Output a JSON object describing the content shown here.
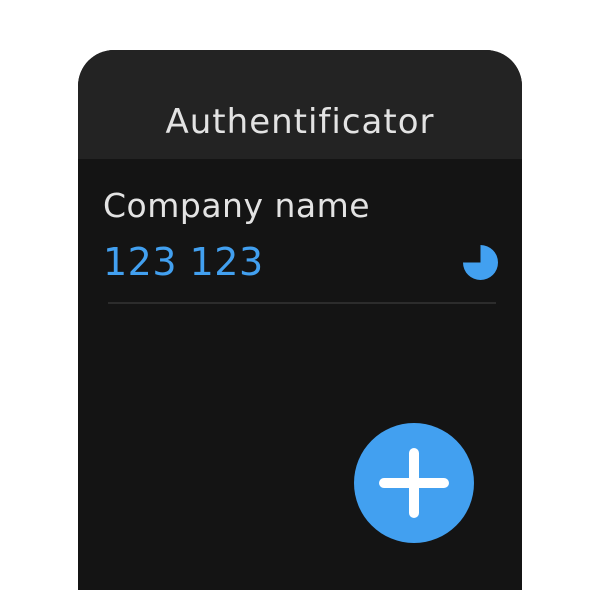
{
  "app": {
    "title": "Authentificator"
  },
  "accounts": [
    {
      "name": "Company name",
      "code": "123 123",
      "timer_remaining_fraction": 0.75
    }
  ],
  "fab": {
    "icon": "plus-icon"
  },
  "colors": {
    "accent": "#42a0f0",
    "background": "#141414",
    "header": "#232323",
    "text": "#e3e3e3"
  }
}
